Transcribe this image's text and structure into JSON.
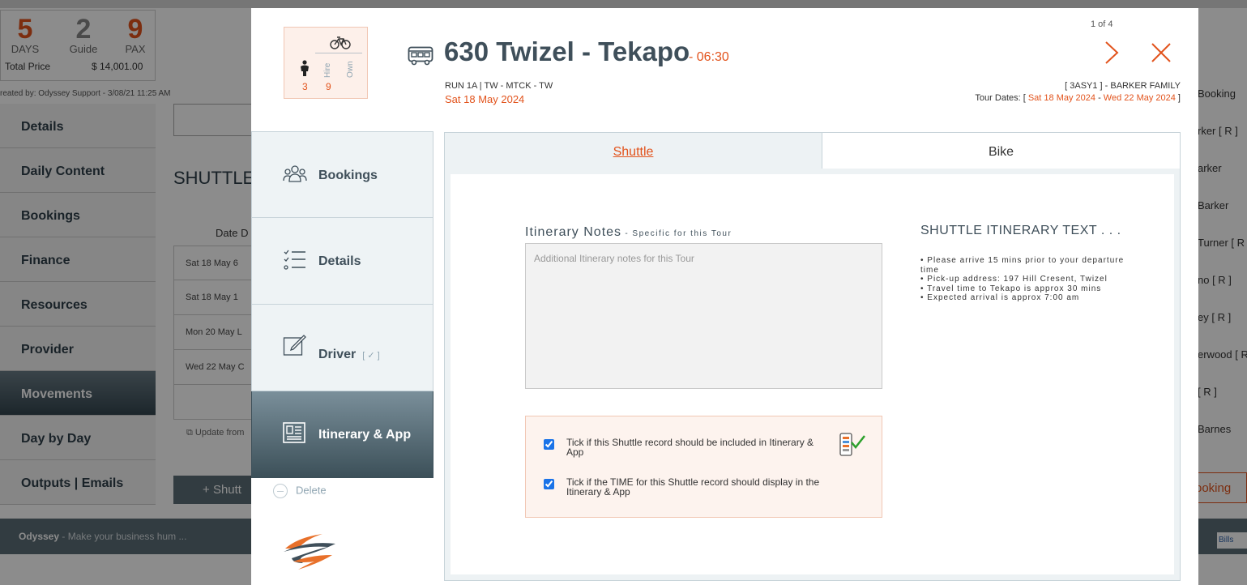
{
  "background": {
    "stats": {
      "days": {
        "value": "5",
        "label": "DAYS"
      },
      "guide": {
        "value": "2",
        "label": "Guide"
      },
      "pax": {
        "value": "9",
        "label": "PAX"
      },
      "total_label": "Total Price",
      "total_value": "$ 14,001.00"
    },
    "created_by": "reated by: Odyssey Support - 3/08/21 11:25 AM",
    "menu": [
      "Details",
      "Daily Content",
      "Bookings",
      "Finance",
      "Resources",
      "Provider",
      "Movements",
      "Day by Day",
      "Outputs | Emails"
    ],
    "section_title": "SHUTTLE",
    "date_header": "Date",
    "date_header_2": "D",
    "rows": [
      "Sat 18 May",
      "Sat 18 May",
      "Mon 20 May",
      "Wed 22 May"
    ],
    "row_cells": [
      "6",
      "1",
      "L",
      "C"
    ],
    "update_label": "Update from",
    "shuttle_button": "Shutt",
    "right_list": [
      "Booking",
      "rker [ R ]",
      "arker",
      "Barker",
      "Turner [ R",
      "no [ R ]",
      "ey [ R ]",
      "erwood [ R",
      "[ R ]",
      "Barnes"
    ],
    "right_booking_button": "ooking",
    "footer_brand": "Odyssey",
    "footer_tagline": " - Make your business hum ...",
    "bills": "Bills"
  },
  "modal": {
    "pax_box": {
      "hire_label": "Hire",
      "own_label": "Own",
      "count1": "3",
      "count2": "9"
    },
    "title": "630 Twizel - Tekapo",
    "time": "- 06:30",
    "run_line": "RUN 1A | TW - MTCK - TW",
    "date": "Sat 18 May 2024",
    "pager": "1 of 4",
    "booking_ref": "[ 3ASY1 ] - BARKER FAMILY",
    "tour_dates_label": "Tour Dates: [ ",
    "tour_start": "Sat 18 May 2024",
    "tour_sep": " - ",
    "tour_end": "Wed 22 May 2024",
    "tour_close": " ]",
    "nav": {
      "bookings": "Bookings",
      "details": "Details",
      "driver": "Driver",
      "driver_tick": "[ ✓ ]",
      "itinerary": "Itinerary & App"
    },
    "delete_label": "Delete",
    "tabs": {
      "shuttle": "Shuttle",
      "bike": "Bike"
    },
    "notes": {
      "title": "Itinerary Notes",
      "subtitle": " - Specific for this Tour",
      "placeholder": "Additional Itinerary notes for this Tour",
      "value": ""
    },
    "itinerary": {
      "title": "SHUTTLE ITINERARY TEXT . . .",
      "items": [
        "• Please arrive 15 mins prior to your departure time",
        "• Pick-up address: 197 Hill Cresent, Twizel",
        "• Travel time to Tekapo is approx 30 mins",
        "• Expected arrival is approx 7:00 am"
      ]
    },
    "checks": {
      "include_label": "Tick if this Shuttle record should be included in Itinerary & App",
      "include_checked": true,
      "time_label": "Tick if the TIME for this Shuttle record should  display in the Itinerary & App",
      "time_checked": true
    },
    "colors": {
      "accent": "#e2531c",
      "slate": "#3f4f5a",
      "tick_green": "#2ca02c"
    }
  }
}
